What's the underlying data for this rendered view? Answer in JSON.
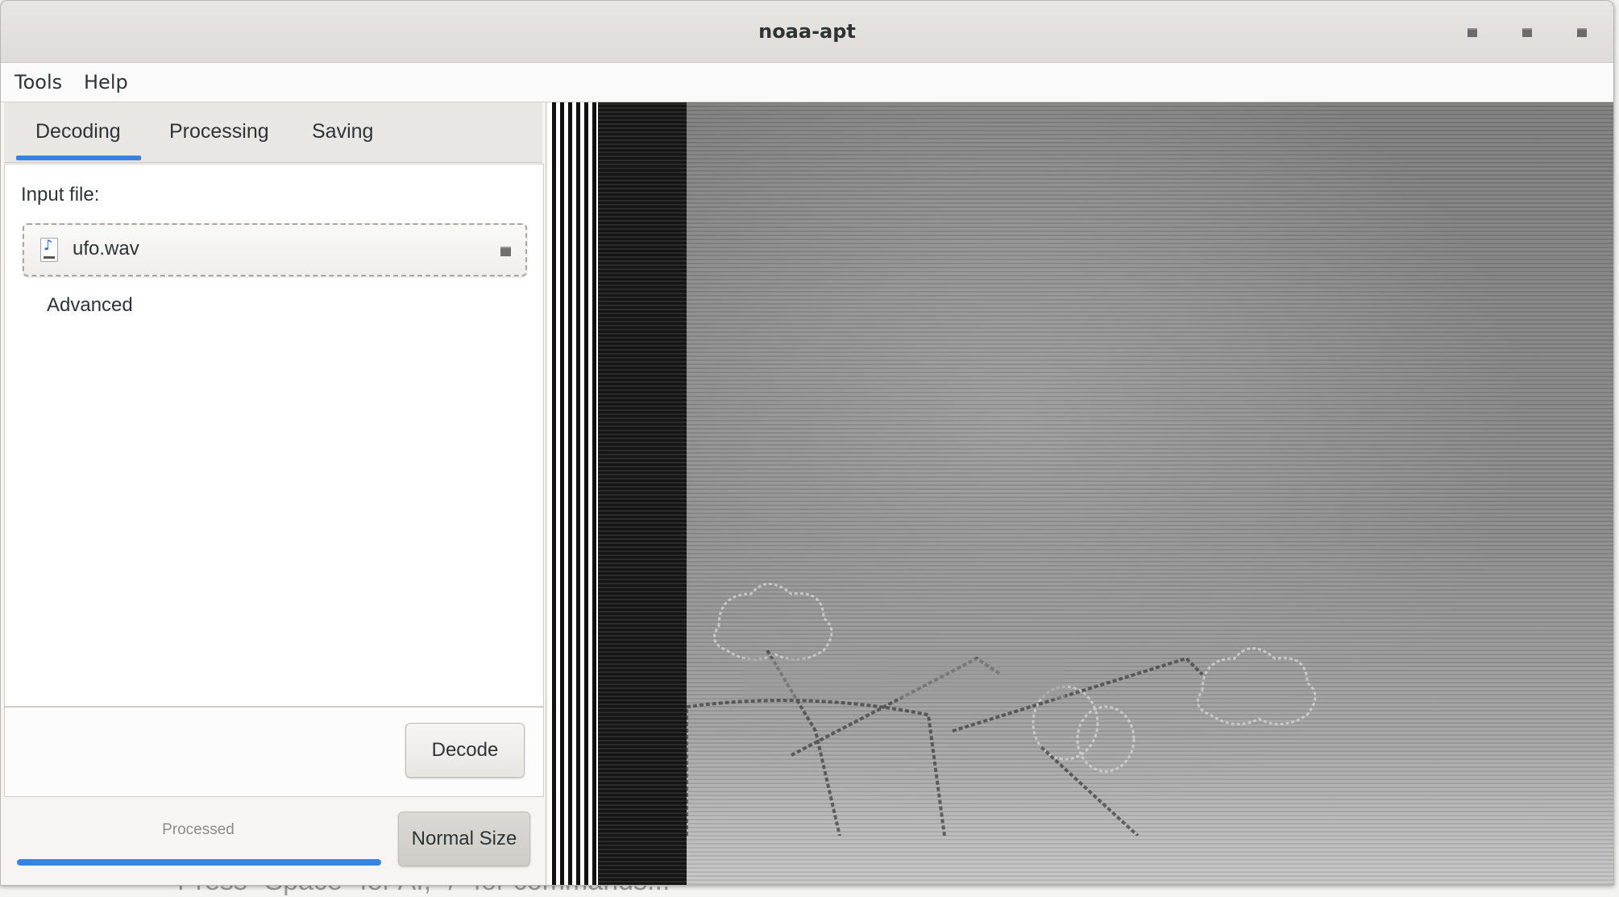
{
  "window": {
    "title": "noaa-apt"
  },
  "menu": {
    "items": [
      "Tools",
      "Help"
    ]
  },
  "tabs": [
    {
      "label": "Decoding",
      "active": true
    },
    {
      "label": "Processing",
      "active": false
    },
    {
      "label": "Saving",
      "active": false
    }
  ],
  "decoding": {
    "input_label": "Input file:",
    "file_name": "ufo.wav",
    "file_icon": "audio-wav-file-icon",
    "advanced_label": "Advanced",
    "decode_button": "Decode"
  },
  "status": {
    "processed_label": "Processed",
    "progress": 1.0,
    "normal_size_button": "Normal Size"
  },
  "background_hint": "Press \"Space\" for AI, \"/\" for commands...",
  "colors": {
    "accent": "#3584e4",
    "text": "#2e3436",
    "window_bg": "#f6f5f4"
  }
}
